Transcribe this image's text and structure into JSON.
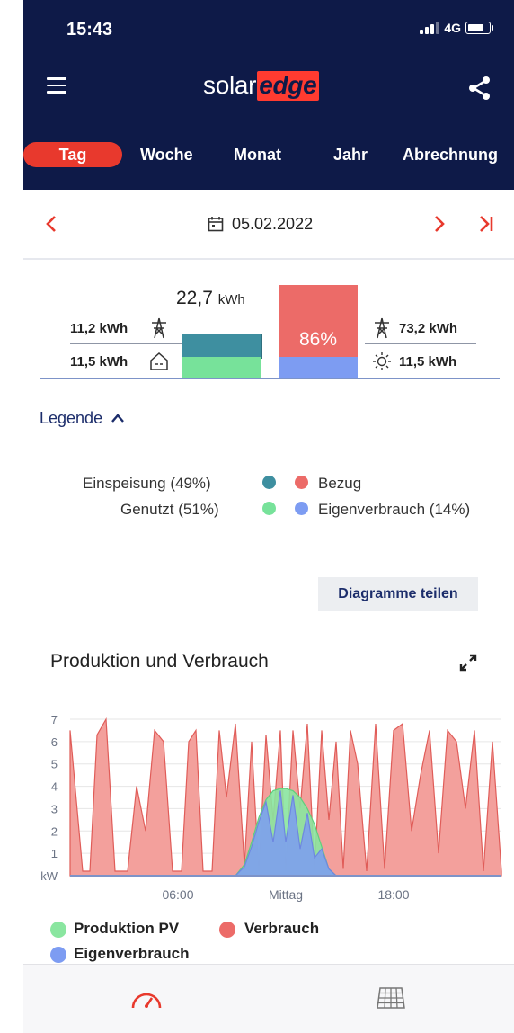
{
  "status": {
    "time": "15:43",
    "network": "4G"
  },
  "header": {
    "logo_part1": "solar",
    "logo_part2": "edge"
  },
  "tabs": [
    {
      "label": "Tag",
      "active": true
    },
    {
      "label": "Woche",
      "active": false
    },
    {
      "label": "Monat",
      "active": false
    },
    {
      "label": "Jahr",
      "active": false
    },
    {
      "label": "Abrechnung",
      "active": false
    }
  ],
  "date": "05.02.2022",
  "summary": {
    "total": "22,7",
    "total_unit": "kWh",
    "left_grid": "11,2 kWh",
    "left_home": "11,5 kWh",
    "percent": "86%",
    "right_grid": "73,2 kWh",
    "right_solar": "11,5 kWh"
  },
  "legend": {
    "toggle_label": "Legende",
    "einspeisung": "Einspeisung (49%)",
    "genutzt": "Genutzt (51%)",
    "bezug": "Bezug",
    "eigenverbrauch": "Eigenverbrauch (14%)"
  },
  "share_button": "Diagramme teilen",
  "production_title": "Produktion und Verbrauch",
  "colors": {
    "navy": "#0e1a48",
    "accent_red": "#e8392d",
    "einspeisung": "#3e8fa0",
    "genutzt": "#77e29a",
    "bezug": "#ec6b68",
    "eigenverbrauch": "#7d9cf2",
    "verbrauch": "#f08f8b",
    "produktion": "#8ae6a0"
  },
  "chart_data": {
    "type": "area",
    "ylabel": "kW",
    "ylim": [
      0,
      7
    ],
    "yticks": [
      "1",
      "2",
      "3",
      "4",
      "5",
      "6",
      "7"
    ],
    "xlabels": [
      "06:00",
      "Mittag",
      "18:00"
    ],
    "xlabel_hours": [
      6,
      12,
      18
    ],
    "x": [
      0,
      0.7,
      1.1,
      1.5,
      2.0,
      2.5,
      3.2,
      3.7,
      4.2,
      4.7,
      5.2,
      5.7,
      6.2,
      6.6,
      7.0,
      7.4,
      7.9,
      8.3,
      8.7,
      9.2,
      9.7,
      10.1,
      10.5,
      10.9,
      11.3,
      11.7,
      12.0,
      12.4,
      12.8,
      13.2,
      13.6,
      14.0,
      14.4,
      14.8,
      15.2,
      15.6,
      16.0,
      16.5,
      17.0,
      17.5,
      18.0,
      18.5,
      19.0,
      19.5,
      20.0,
      20.5,
      21.0,
      21.5,
      22.0,
      22.5,
      23.0,
      23.5,
      24.0
    ],
    "series": [
      {
        "name": "Verbrauch",
        "values": [
          6.5,
          0.2,
          0.2,
          6.3,
          7.0,
          0.2,
          0.2,
          4.0,
          2.0,
          6.5,
          6.0,
          0.2,
          0.2,
          6.0,
          6.5,
          0.2,
          0.2,
          6.5,
          3.5,
          6.8,
          0.5,
          6.0,
          0.2,
          6.3,
          2.5,
          6.5,
          0.2,
          6.5,
          3.0,
          6.8,
          0.2,
          6.5,
          2.5,
          6.0,
          0.3,
          6.5,
          5.0,
          0.2,
          6.8,
          0.3,
          6.5,
          6.8,
          2.0,
          4.5,
          6.5,
          1.0,
          6.5,
          6.0,
          3.0,
          6.5,
          0.2,
          6.0,
          0.2
        ]
      },
      {
        "name": "Produktion PV",
        "values": [
          0,
          0,
          0,
          0,
          0,
          0,
          0,
          0,
          0,
          0,
          0,
          0,
          0,
          0,
          0,
          0,
          0,
          0,
          0,
          0,
          0.5,
          1.5,
          2.6,
          3.4,
          3.8,
          3.9,
          3.9,
          3.8,
          3.5,
          3.0,
          2.3,
          1.3,
          0.3,
          0,
          0,
          0,
          0,
          0,
          0,
          0,
          0,
          0,
          0,
          0,
          0,
          0,
          0,
          0,
          0,
          0,
          0,
          0,
          0
        ]
      },
      {
        "name": "Eigenverbrauch",
        "values": [
          0,
          0,
          0,
          0,
          0,
          0,
          0,
          0,
          0,
          0,
          0,
          0,
          0,
          0,
          0,
          0,
          0,
          0,
          0,
          0,
          0.4,
          1.3,
          2.4,
          3.3,
          1.5,
          3.8,
          1.5,
          3.6,
          1.2,
          2.8,
          0.8,
          1.2,
          0.3,
          0,
          0,
          0,
          0,
          0,
          0,
          0,
          0,
          0,
          0,
          0,
          0,
          0,
          0,
          0,
          0,
          0,
          0,
          0,
          0
        ]
      }
    ],
    "legend": [
      "Produktion PV",
      "Verbrauch",
      "Eigenverbrauch"
    ]
  }
}
